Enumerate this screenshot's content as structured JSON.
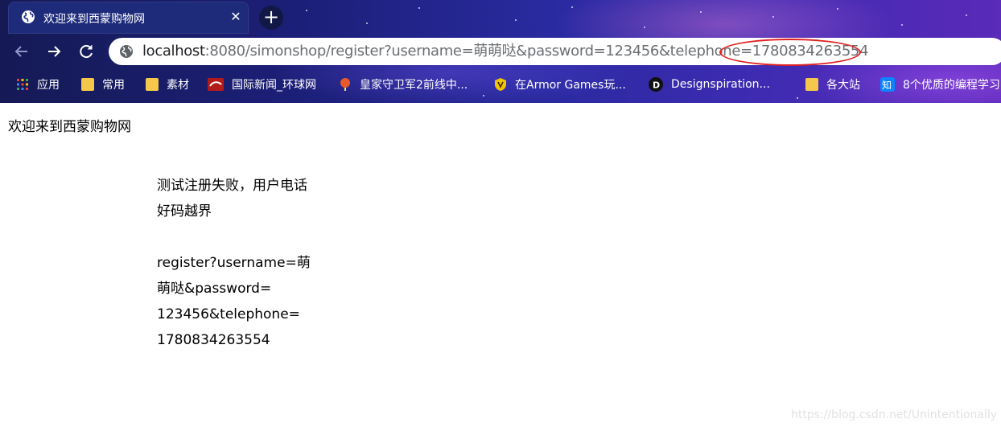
{
  "tab": {
    "title": "欢迎来到西蒙购物网",
    "close_label": "✕",
    "new_tab_label": "+"
  },
  "address_bar": {
    "host": "localhost",
    "rest": ":8080/simonshop/register?username=萌萌哒&password=123456&telephone=1780834263554"
  },
  "bookmarks": [
    {
      "label": "应用",
      "icon": "apps-grid-icon"
    },
    {
      "label": "常用",
      "icon": "folder-icon"
    },
    {
      "label": "素材",
      "icon": "folder-icon"
    },
    {
      "label": "国际新闻_环球网",
      "icon": "huanqiu-icon"
    },
    {
      "label": "皇家守卫军2前线中...",
      "icon": "balloon-icon"
    },
    {
      "label": "在Armor Games玩...",
      "icon": "armor-shield-icon"
    },
    {
      "label": "Designspiration...",
      "icon": "designspiration-icon"
    },
    {
      "label": "各大站",
      "icon": "folder-icon"
    },
    {
      "label": "8个优质的编程学习",
      "icon": "zhihu-icon"
    }
  ],
  "page": {
    "heading": "欢迎来到西蒙购物网",
    "message_lines": [
      "测试注册失败，用户电话",
      "好码越界"
    ],
    "url_lines": [
      "register?username=萌",
      "萌哒&password=",
      "123456&telephone=",
      "1780834263554"
    ]
  },
  "watermark": "https://blog.csdn.net/Unintentionally",
  "colors": {
    "highlight_oval": "#e02020",
    "folder": "#f5c84c"
  }
}
